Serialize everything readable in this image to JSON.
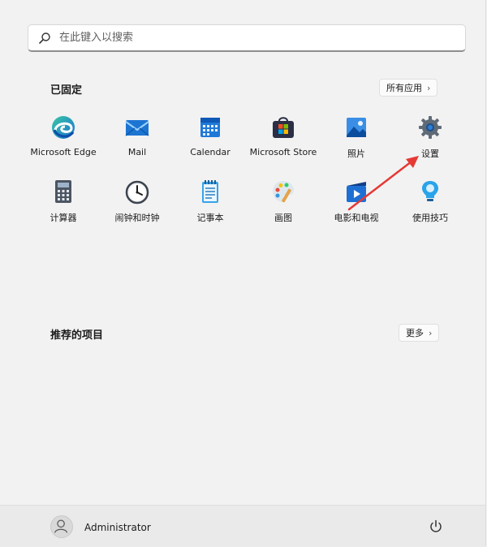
{
  "search": {
    "placeholder": "在此键入以搜索",
    "icon": "search-icon"
  },
  "pinned": {
    "title": "已固定",
    "all_apps_label": "所有应用",
    "apps": [
      {
        "label": "Microsoft Edge",
        "icon": "edge-icon"
      },
      {
        "label": "Mail",
        "icon": "mail-icon"
      },
      {
        "label": "Calendar",
        "icon": "calendar-icon"
      },
      {
        "label": "Microsoft Store",
        "icon": "store-icon"
      },
      {
        "label": "照片",
        "icon": "photos-icon"
      },
      {
        "label": "设置",
        "icon": "settings-icon"
      },
      {
        "label": "计算器",
        "icon": "calculator-icon"
      },
      {
        "label": "闹钟和时钟",
        "icon": "alarm-clock-icon"
      },
      {
        "label": "记事本",
        "icon": "notepad-icon"
      },
      {
        "label": "画图",
        "icon": "paint-icon"
      },
      {
        "label": "电影和电视",
        "icon": "movies-tv-icon"
      },
      {
        "label": "使用技巧",
        "icon": "tips-icon"
      }
    ]
  },
  "recommended": {
    "title": "推荐的项目",
    "more_label": "更多"
  },
  "account": {
    "username": "Administrator",
    "avatar_icon": "user-avatar-icon"
  },
  "power_icon": "power-icon",
  "colors": {
    "accent": "#0067c0",
    "annotation_arrow": "#e53935"
  }
}
